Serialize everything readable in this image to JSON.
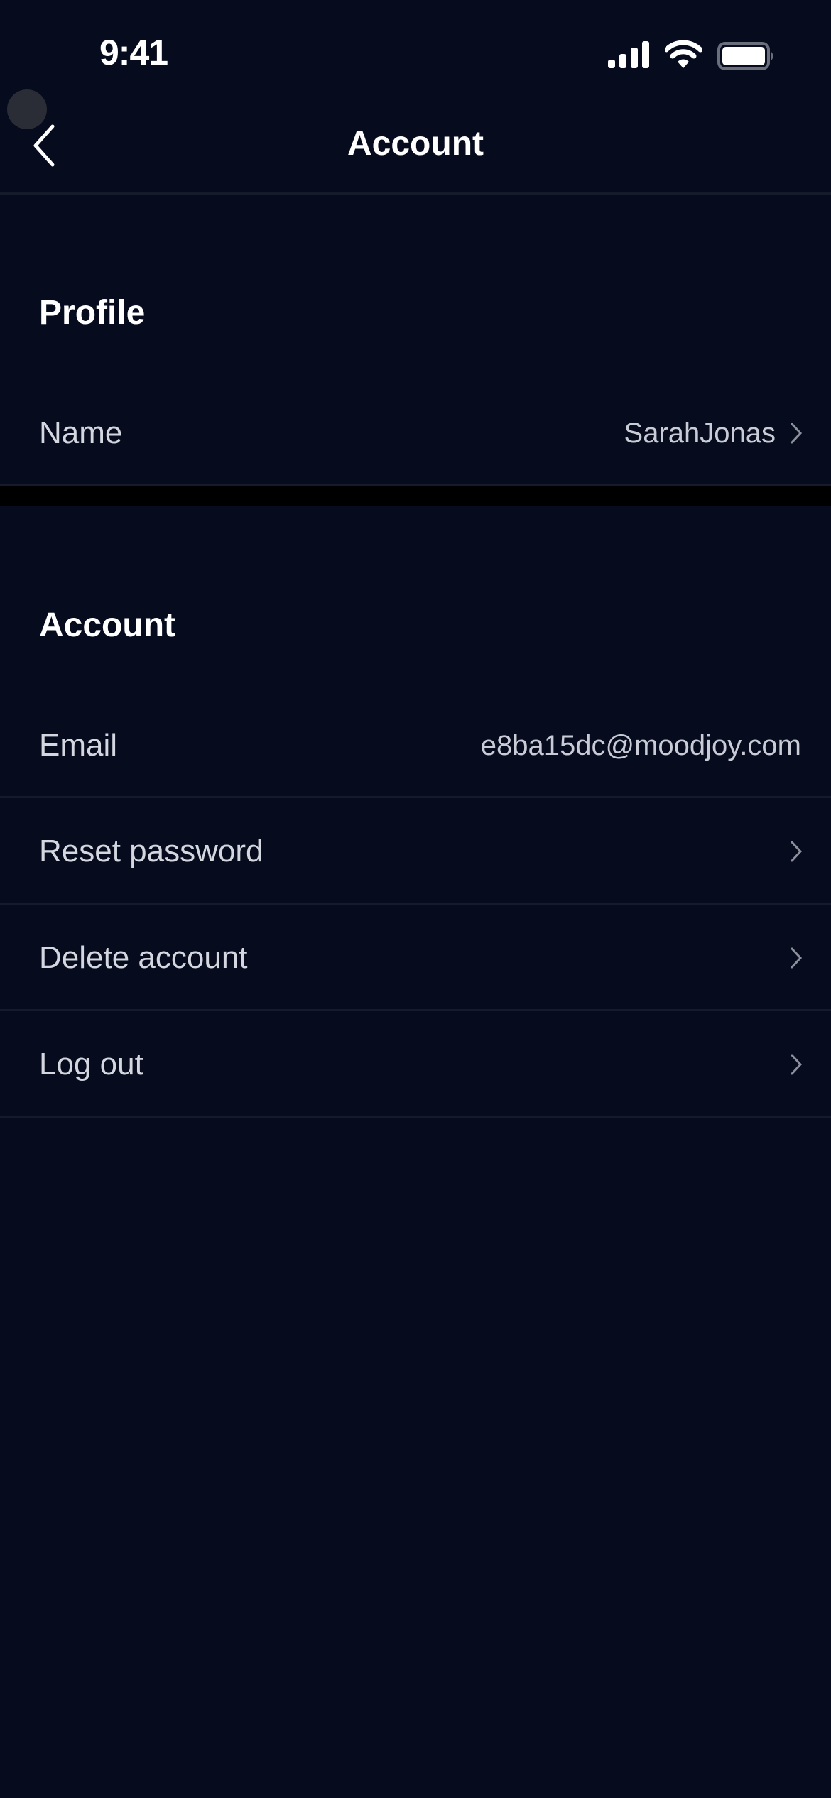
{
  "status_bar": {
    "time": "9:41",
    "icons": [
      "signal-icon",
      "wifi-icon",
      "battery-icon"
    ]
  },
  "nav": {
    "title": "Account",
    "back_icon": "chevron-left-icon"
  },
  "sections": [
    {
      "title": "Profile",
      "rows": [
        {
          "label": "Name",
          "value": "SarahJonas",
          "chevron": true
        }
      ]
    },
    {
      "title": "Account",
      "rows": [
        {
          "label": "Email",
          "value": "e8ba15dc@moodjoy.com",
          "chevron": false
        },
        {
          "label": "Reset password",
          "value": "",
          "chevron": true
        },
        {
          "label": "Delete account",
          "value": "",
          "chevron": true
        },
        {
          "label": "Log out",
          "value": "",
          "chevron": true
        }
      ]
    }
  ],
  "colors": {
    "background": "#060c1e",
    "divider": "#161b2c",
    "text_primary": "#ffffff",
    "text_secondary": "#d4d7e0"
  }
}
